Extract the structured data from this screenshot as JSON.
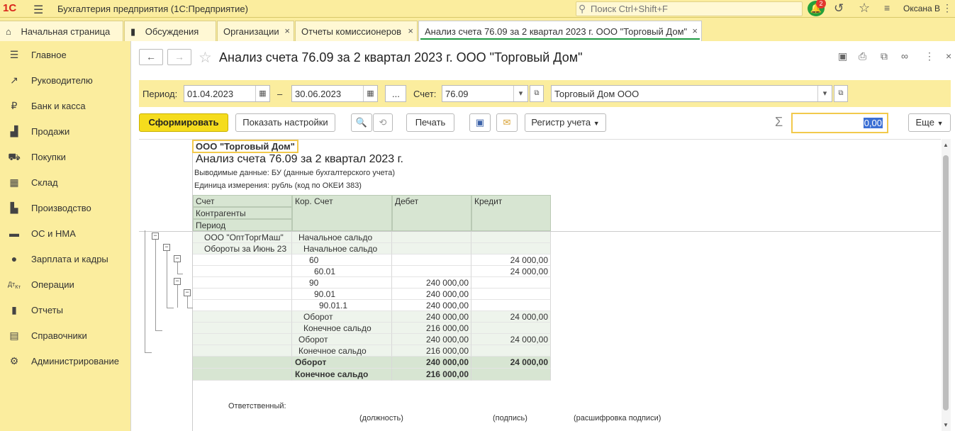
{
  "topbar": {
    "logo": "1С",
    "app_title": "Бухгалтерия предприятия  (1С:Предприятие)",
    "search_placeholder": "Поиск Ctrl+Shift+F",
    "notifications_count": "2",
    "user": "Оксана В"
  },
  "tabs": [
    {
      "label": "Начальная страница"
    },
    {
      "label": "Обсуждения"
    },
    {
      "label": "Организации"
    },
    {
      "label": "Отчеты комиссионеров"
    },
    {
      "label": "Анализ счета 76.09 за 2 квартал 2023 г. ООО \"Торговый Дом\""
    }
  ],
  "sidebar": {
    "items": [
      {
        "label": "Главное",
        "icon": "menu-icon"
      },
      {
        "label": "Руководителю",
        "icon": "trend-icon"
      },
      {
        "label": "Банк и касса",
        "icon": "ruble-icon"
      },
      {
        "label": "Продажи",
        "icon": "bag-icon"
      },
      {
        "label": "Покупки",
        "icon": "cart-icon"
      },
      {
        "label": "Склад",
        "icon": "warehouse-icon"
      },
      {
        "label": "Производство",
        "icon": "factory-icon"
      },
      {
        "label": "ОС и НМА",
        "icon": "truck-icon"
      },
      {
        "label": "Зарплата и кадры",
        "icon": "person-icon"
      },
      {
        "label": "Операции",
        "icon": "dt-kt-icon"
      },
      {
        "label": "Отчеты",
        "icon": "chart-icon"
      },
      {
        "label": "Справочники",
        "icon": "book-icon"
      },
      {
        "label": "Администрирование",
        "icon": "gear-icon"
      }
    ]
  },
  "document": {
    "title": "Анализ счета 76.09 за 2 квартал 2023 г. ООО \"Торговый Дом\""
  },
  "panel": {
    "period_label": "Период:",
    "date_from": "01.04.2023",
    "dash": "–",
    "date_to": "30.06.2023",
    "ellipsis": "...",
    "account_label": "Счет:",
    "account": "76.09",
    "organization": "Торговый Дом ООО"
  },
  "commands": {
    "generate": "Сформировать",
    "show_settings": "Показать настройки",
    "print": "Печать",
    "register": "Регистр учета",
    "more": "Еще",
    "sum_value": "0,00"
  },
  "report": {
    "org_name": "ООО \"Торговый Дом\"",
    "title": "Анализ счета 76.09 за 2 квартал 2023 г.",
    "output_data": "Выводимые данные:  БУ (данные бухгалтерского учета)",
    "unit": "Единица измерения:  рубль (код по ОКЕИ 383)",
    "headers": {
      "account": "Счет",
      "counterparties": "Контрагенты",
      "period": "Период",
      "corr_account": "Кор. Счет",
      "debit": "Дебет",
      "credit": "Кредит"
    },
    "rows": [
      {
        "a": "ООО \"ОптТоргМаш\"",
        "k": "Начальное сальдо",
        "d": "",
        "c": ""
      },
      {
        "a": "Обороты за Июнь 23",
        "k": "Начальное сальдо",
        "d": "",
        "c": ""
      },
      {
        "a": "",
        "k": "60",
        "d": "",
        "c": "24 000,00"
      },
      {
        "a": "",
        "k": "60.01",
        "d": "",
        "c": "24 000,00"
      },
      {
        "a": "",
        "k": "90",
        "d": "240 000,00",
        "c": ""
      },
      {
        "a": "",
        "k": "90.01",
        "d": "240 000,00",
        "c": ""
      },
      {
        "a": "",
        "k": "90.01.1",
        "d": "240 000,00",
        "c": ""
      },
      {
        "a": "",
        "k": "Оборот",
        "d": "240 000,00",
        "c": "24 000,00"
      },
      {
        "a": "",
        "k": "Конечное сальдо",
        "d": "216 000,00",
        "c": ""
      },
      {
        "a": "",
        "k": "Оборот",
        "d": "240 000,00",
        "c": "24 000,00"
      },
      {
        "a": "",
        "k": "Конечное сальдо",
        "d": "216 000,00",
        "c": ""
      }
    ],
    "total_turnover": {
      "k": "Оборот",
      "d": "240 000,00",
      "c": "24 000,00"
    },
    "total_balance": {
      "k": "Конечное сальдо",
      "d": "216 000,00",
      "c": ""
    },
    "responsible": "Ответственный:",
    "position": "(должность)",
    "signature": "(подпись)",
    "signature_decode": "(расшифровка подписи)"
  }
}
